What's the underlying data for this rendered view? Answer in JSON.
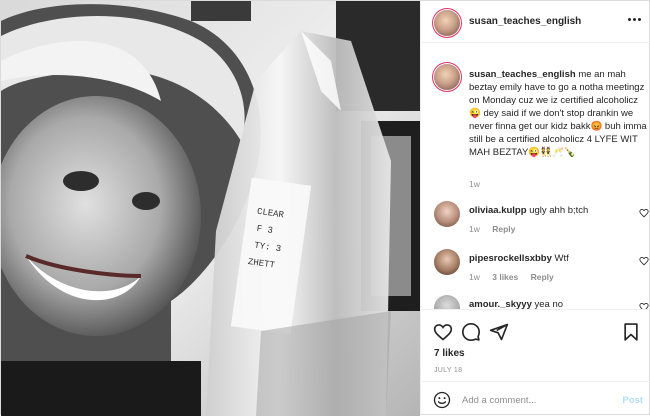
{
  "post": {
    "username": "susan_teaches_english",
    "caption_username": "susan_teaches_english",
    "caption_text": "me an mah beztay emily have to go a notha meetingz on Monday cuz we iz certified alcoholicz 😜 dey said if we don't stop drankin we never finna get our kidz bakk😡 buh imma still be a certified alcoholicz 4 LYFE WIT MAH BEZTAY😜👯🥂🍾",
    "caption_time": "1w",
    "likes": "7 likes",
    "date": "JULY 18"
  },
  "comments": [
    {
      "username": "oliviaa.kulpp",
      "text": "ugly ahh b;tch",
      "time": "1w",
      "likes": "",
      "reply": "Reply"
    },
    {
      "username": "pipesrockellsxbby",
      "text": "Wtf",
      "time": "1w",
      "likes": "3 likes",
      "reply": "Reply"
    },
    {
      "username": "amour._skyyy",
      "text": "yea no",
      "time": "",
      "likes": "",
      "reply": ""
    }
  ],
  "composer": {
    "placeholder": "Add a comment...",
    "post_label": "Post"
  },
  "icons": {
    "more": "more-options-icon",
    "like": "heart-icon",
    "comment": "comment-icon",
    "share": "share-icon",
    "save": "bookmark-icon",
    "emoji": "emoji-icon",
    "comment_like": "small-heart-icon"
  },
  "colors": {
    "story_ring": "#e1306c",
    "post_button_disabled": "#b2dffc",
    "muted_text": "#8e8e8e"
  }
}
